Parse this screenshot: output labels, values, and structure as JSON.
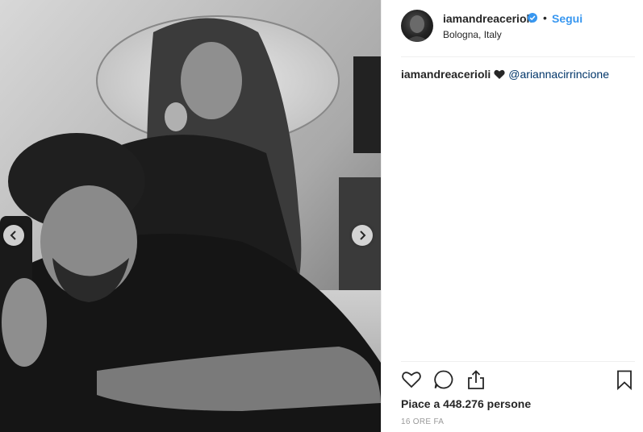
{
  "post": {
    "username": "iamandreacerioli",
    "follow_label": "Segui",
    "dot": "•",
    "location": "Bologna, Italy",
    "caption_username": "iamandreacerioli",
    "caption_mention": "@ariannacirrincione",
    "likes_text": "Piace a 448.276 persone",
    "timestamp": "16 ORE FA"
  },
  "icons": {
    "verified": "verified-badge-icon",
    "heart_emoji": "black-heart-icon",
    "like": "heart-icon",
    "comment": "comment-icon",
    "share": "share-icon",
    "save": "bookmark-icon",
    "prev": "chevron-left-icon",
    "next": "chevron-right-icon"
  },
  "colors": {
    "accent": "#3897f0",
    "mention": "#003569",
    "timestamp": "#999999"
  }
}
